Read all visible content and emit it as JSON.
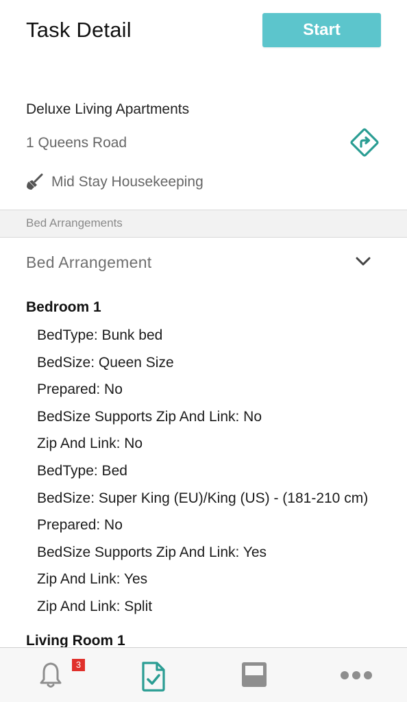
{
  "header": {
    "title": "Task Detail",
    "start_label": "Start"
  },
  "property": {
    "name": "Deluxe Living Apartments",
    "address": "1  Queens Road",
    "task_type": "Mid Stay Housekeeping"
  },
  "section": {
    "label": "Bed Arrangements"
  },
  "accordion": {
    "label": "Bed Arrangement"
  },
  "rooms": [
    {
      "title": "Bedroom 1"
    },
    {
      "title": "Living Room 1"
    }
  ],
  "bed_lines": [
    "BedType: Bunk bed",
    "BedSize: Queen Size",
    "Prepared: No",
    "BedSize Supports Zip And Link: No",
    "Zip And Link: No",
    "BedType: Bed",
    "BedSize: Super King (EU)/King (US) - (181-210 cm)",
    "Prepared: No",
    "BedSize Supports Zip And Link: Yes",
    "Zip And Link: Yes",
    "Zip And Link: Split"
  ],
  "tabbar": {
    "notifications_badge": "3",
    "active_tab": "tasks"
  },
  "colors": {
    "accent": "#5cc5cc",
    "teal_icon": "#2a9d93",
    "badge": "#e0302b",
    "tab_inactive": "#8e8e8e"
  }
}
